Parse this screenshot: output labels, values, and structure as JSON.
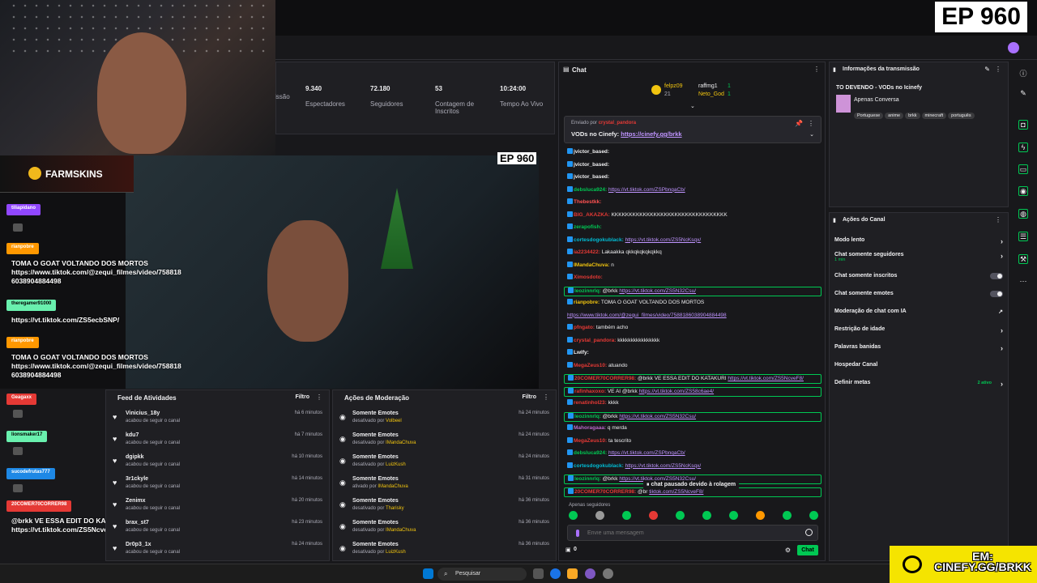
{
  "overlay_ep": "EP 960",
  "inner_ep": "EP 960",
  "farmskins": "FARMSKINS",
  "stats": [
    {
      "value": "",
      "label": "issão"
    },
    {
      "value": "9.340",
      "label": "Espectadores"
    },
    {
      "value": "72.180",
      "label": "Seguidores"
    },
    {
      "value": "53",
      "label": "Contagem de Inscritos"
    },
    {
      "value": "10:24:00",
      "label": "Tempo Ao Vivo"
    }
  ],
  "overlay_chat": [
    {
      "name": "tiliapidano",
      "color": "#9147ff",
      "msg": ""
    },
    {
      "name": "rianpobre",
      "color": "#ff9800",
      "msg": "TOMA O GOAT VOLTANDO DOS MORTOS\nhttps://www.tiktok.com/@zequi_filmes/video/758818\n6038904884498"
    },
    {
      "name": "theregamer91000",
      "color": "#69f0ae",
      "msg": "https://vt.tiktok.com/ZS5ecbSNP/"
    },
    {
      "name": "rianpobre",
      "color": "#ff9800",
      "msg": "TOMA O GOAT VOLTANDO DOS MORTOS\nhttps://www.tiktok.com/@zequi_filmes/video/758818\n6038904884498"
    },
    {
      "name": "Geagaxx",
      "color": "#e53935",
      "msg": ""
    },
    {
      "name": "lionsmaker17",
      "color": "#69f0ae",
      "msg": ""
    },
    {
      "name": "sucodefrutas777",
      "color": "#1e88e5",
      "msg": ""
    },
    {
      "name": "20COMER70CORRER98",
      "color": "#e53935",
      "msg": "@brkk VE ESSA EDIT DO KATAKURI\nhttps://vt.tiktok.com/ZS5NcveF8/"
    }
  ],
  "feed": {
    "title": "Feed de Atividades",
    "filter": "Filtro",
    "rows": [
      {
        "user": "Vinicius_18y",
        "action": "acabou de seguir o canal",
        "time": "há 6 minutos"
      },
      {
        "user": "kdu7",
        "action": "acabou de seguir o canal",
        "time": "há 7 minutos"
      },
      {
        "user": "dgipkk",
        "action": "acabou de seguir o canal",
        "time": "há 10 minutos"
      },
      {
        "user": "3r1ckyle",
        "action": "acabou de seguir o canal",
        "time": "há 14 minutos"
      },
      {
        "user": "Zenimx",
        "action": "acabou de seguir o canal",
        "time": "há 20 minutos"
      },
      {
        "user": "brax_st7",
        "action": "acabou de seguir o canal",
        "time": "há 23 minutos"
      },
      {
        "user": "Dr0p3_1x",
        "action": "acabou de seguir o canal",
        "time": "há 24 minutos"
      }
    ]
  },
  "mod": {
    "title": "Ações de Moderação",
    "filter": "Filtro",
    "rows": [
      {
        "action": "Somente Emotes",
        "by": "desativado por",
        "user": "Volbeel",
        "time": "há 24 minutos"
      },
      {
        "action": "Somente Emotes",
        "by": "desativado por",
        "user": "IMandaChuva",
        "time": "há 24 minutos"
      },
      {
        "action": "Somente Emotes",
        "by": "desativado por",
        "user": "LuizKush",
        "time": "há 24 minutos"
      },
      {
        "action": "Somente Emotes",
        "by": "ativado por",
        "user": "IMandaChuva",
        "time": "há 31 minutos"
      },
      {
        "action": "Somente Emotes",
        "by": "desativado por",
        "user": "Tharisky",
        "time": "há 36 minutos"
      },
      {
        "action": "Somente Emotes",
        "by": "desativado por",
        "user": "IMandaChuva",
        "time": "há 36 minutos"
      },
      {
        "action": "Somente Emotes",
        "by": "desativado por",
        "user": "LuizKush",
        "time": "há 36 minutos"
      }
    ]
  },
  "chat": {
    "title": "Chat",
    "leaders": [
      {
        "name": "felpz09",
        "value": "21"
      },
      {
        "name": "raffmg1",
        "value": "1"
      },
      {
        "name": "Neto_God",
        "value": "1"
      }
    ],
    "pinned_by_label": "Enviado por",
    "pinned_by_user": "crystal_pandora",
    "pinned_text": "VODs no Cinefy:",
    "pinned_link": "https://cinefy.gg/brkk",
    "lines": [
      {
        "user": "jvictor_based:",
        "color": "#efeff1",
        "text": "",
        "link": "",
        "hl": false
      },
      {
        "user": "jvictor_based:",
        "color": "#efeff1",
        "text": "",
        "link": "",
        "hl": false
      },
      {
        "user": "jvictor_based:",
        "color": "#efeff1",
        "text": "",
        "link": "",
        "hl": false
      },
      {
        "user": "debsluca924:",
        "color": "#00c853",
        "text": "",
        "link": "https://vt.tiktok.com/ZSPbnqaCb/",
        "hl": false
      },
      {
        "user": "Thebestkk:",
        "color": "#ff5252",
        "text": "",
        "link": "",
        "hl": false
      },
      {
        "user": "BIG_AKAZKA:",
        "color": "#e53935",
        "text": "KKKKKKKKKKKKKKKKKKKKKKKKKKKKKKKKK",
        "link": "",
        "hl": false
      },
      {
        "user": "zerapofish:",
        "color": "#00c853",
        "text": "",
        "link": "",
        "hl": false
      },
      {
        "user": "cortesdogokublack:",
        "color": "#00bcd4",
        "text": "",
        "link": "https://vt.tiktok.com/ZS5NcKsqx/",
        "hl": false
      },
      {
        "user": "ia2234422:",
        "color": "#e53935",
        "text": "Lakaakka qkkqkqkqkqkkq",
        "link": "",
        "hl": false
      },
      {
        "user": "IMandaChuva:",
        "color": "#f1c40f",
        "text": "n",
        "link": "",
        "hl": false
      },
      {
        "user": "Ximosdoto:",
        "color": "#e53935",
        "text": "",
        "link": "",
        "hl": false
      },
      {
        "user": "leozinnrlq:",
        "color": "#00c853",
        "text": "@brkk",
        "link": "https://vt.tiktok.com/ZS5N32Csu/",
        "hl": true
      },
      {
        "user": "rianpobre:",
        "color": "#f1c40f",
        "text": "TOMA O GOAT VOLTANDO DOS MORTOS",
        "link": "",
        "hl": false
      },
      {
        "user": "",
        "color": "#efeff1",
        "text": "",
        "link": "https://www.tiktok.com/@zequi_filmes/video/7588186038904884498",
        "hl": false
      },
      {
        "user": "pfngato:",
        "color": "#e53935",
        "text": "também acho",
        "link": "",
        "hl": false
      },
      {
        "user": "crystal_pandora:",
        "color": "#e53935",
        "text": "kkkkkkkkkkkkkkkk",
        "link": "",
        "hl": false
      },
      {
        "user": "Lwlfy:",
        "color": "#efeff1",
        "text": "",
        "link": "",
        "hl": false
      },
      {
        "user": "MegaZeus10:",
        "color": "#e53935",
        "text": "atuando",
        "link": "",
        "hl": false
      },
      {
        "user": "20COMER70CORRER98:",
        "color": "#e53935",
        "text": "@brkk VE ESSA EDIT DO KATAKURI",
        "link": "https://vt.tiktok.com/ZS5NcveF8/",
        "hl": true
      },
      {
        "user": "rafinhaxoxo:",
        "color": "#e53935",
        "text": "VE AI @brkk",
        "link": "https://vt.tiktok.com/ZS58c6ae4/",
        "hl": true
      },
      {
        "user": "renatinhol23:",
        "color": "#e53935",
        "text": "kkkk",
        "link": "",
        "hl": false
      },
      {
        "user": "leozinnrlq:",
        "color": "#00c853",
        "text": "@brkk",
        "link": "https://vt.tiktok.com/ZS5N32Csu/",
        "hl": true
      },
      {
        "user": "Mahoragaaa:",
        "color": "#ba68c8",
        "text": "q merda",
        "link": "",
        "hl": false
      },
      {
        "user": "MegaZeus10:",
        "color": "#e53935",
        "text": "ta tescrito",
        "link": "",
        "hl": false
      },
      {
        "user": "debsluca924:",
        "color": "#00c853",
        "text": "",
        "link": "https://vt.tiktok.com/ZSPbnqaCb/",
        "hl": false
      },
      {
        "user": "cortesdogokublack:",
        "color": "#00bcd4",
        "text": "",
        "link": "https://vt.tiktok.com/ZS5NcKsqx/",
        "hl": false
      },
      {
        "user": "leozinnrlq:",
        "color": "#00c853",
        "text": "@brkk",
        "link": "https://vt.tiktok.com/ZS5N32Csu/",
        "hl": true
      },
      {
        "user": "20COMER70CORRER98:",
        "color": "#e53935",
        "text": "@br",
        "link": "tiktok.com/ZS5NcveF8/",
        "hl": true
      }
    ],
    "paused": "chat pausado devido à rolagem",
    "followers_only": "Apenas seguidores",
    "placeholder": "Envie uma mensagem",
    "points": "0",
    "send_label": "Chat"
  },
  "info": {
    "title": "Informações da transmissão",
    "stream_title": "TO DEVENDO - VODs no Icinefy",
    "category": "Apenas Conversa",
    "tags": [
      "Portuguese",
      "anime",
      "brkk",
      "minecraft",
      "português"
    ]
  },
  "actions": {
    "title": "Ações do Canal",
    "items": [
      {
        "label": "Modo lento",
        "sub": "",
        "kind": "chev"
      },
      {
        "label": "Chat somente seguidores",
        "sub": "1 min",
        "kind": "chev"
      },
      {
        "label": "Chat somente inscritos",
        "sub": "",
        "kind": "toggle"
      },
      {
        "label": "Chat somente emotes",
        "sub": "",
        "kind": "toggle"
      },
      {
        "label": "Moderação de chat com IA",
        "sub": "",
        "kind": "ext"
      },
      {
        "label": "Restrição de idade",
        "sub": "",
        "kind": "chev"
      },
      {
        "label": "Palavras banidas",
        "sub": "",
        "kind": "chev"
      },
      {
        "label": "Hospedar Canal",
        "sub": "",
        "kind": "none"
      },
      {
        "label": "Definir metas",
        "sub": "2 ativo",
        "kind": "chev"
      }
    ]
  },
  "taskbar": {
    "search": "Pesquisar"
  },
  "cinefy": {
    "line1": "EM:",
    "line2": "CINEFY.GG/BRKK"
  },
  "colors": {
    "accent": "#00c853",
    "twitch_purple": "#a970ff",
    "bg": "#18181b"
  }
}
